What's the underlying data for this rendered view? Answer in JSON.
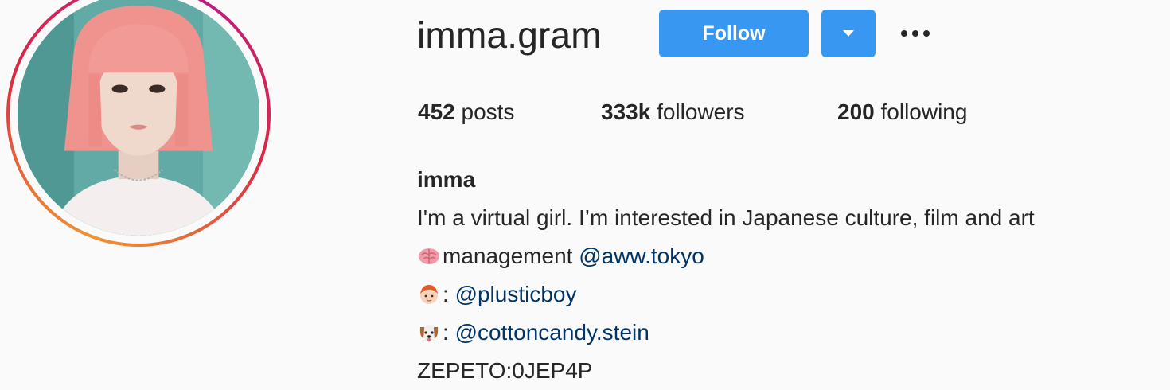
{
  "profile": {
    "username": "imma.gram",
    "follow_label": "Follow",
    "stats": {
      "posts_count": "452",
      "posts_label": " posts",
      "followers_count": "333k",
      "followers_label": " followers",
      "following_count": "200",
      "following_label": " following"
    },
    "bio": {
      "name": "imma",
      "line1": "I'm a virtual girl. I’m interested in Japanese culture, film and art",
      "line2_text": "management ",
      "line2_mention": "@aww.tokyo",
      "line3_sep": ": ",
      "line3_mention": "@plusticboy",
      "line4_sep": ": ",
      "line4_mention": "@cottoncandy.stein",
      "line5": "ZEPETO:0JEP4P"
    },
    "icons": {
      "line2": "brain-icon",
      "line3": "boy-icon",
      "line4": "dog-face-icon"
    },
    "colors": {
      "follow_button": "#3897f0",
      "mention": "#003569",
      "text": "#262626",
      "background": "#fafafa"
    }
  }
}
